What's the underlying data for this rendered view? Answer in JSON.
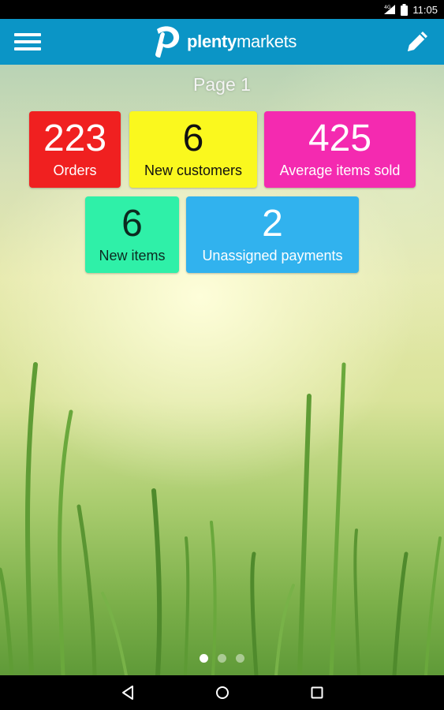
{
  "status_bar": {
    "time": "11:05",
    "icons": [
      "signal-icon",
      "battery-icon"
    ]
  },
  "app_bar": {
    "menu_icon": "hamburger-menu-icon",
    "logo_bold": "plenty",
    "logo_regular": "markets",
    "edit_icon": "pencil-icon",
    "background_color": "#0b95c6"
  },
  "page": {
    "title": "Page 1"
  },
  "tiles": [
    {
      "value": "223",
      "label": "Orders",
      "color": "#f02020"
    },
    {
      "value": "6",
      "label": "New customers",
      "color": "#faf81e"
    },
    {
      "value": "425",
      "label": "Average items sold",
      "color": "#f42ab0"
    },
    {
      "value": "6",
      "label": "New items",
      "color": "#2ff0a8"
    },
    {
      "value": "2",
      "label": "Unassigned payments",
      "color": "#31b2ee"
    }
  ],
  "pager": {
    "page_count": 3,
    "active_index": 0
  },
  "nav_bar": {
    "icons": [
      "back-icon",
      "home-icon",
      "recents-icon"
    ]
  }
}
